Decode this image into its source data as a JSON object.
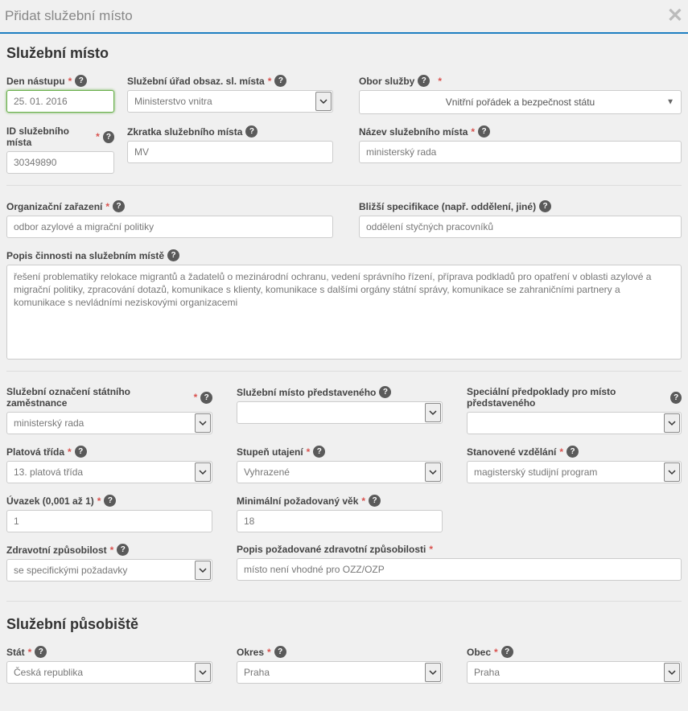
{
  "modal": {
    "title": "Přidat služební místo"
  },
  "section1": {
    "title": "Služební místo"
  },
  "fields": {
    "den_nastupu": {
      "label": "Den nástupu",
      "value": "25. 01. 2016"
    },
    "urad": {
      "label": "Služební úřad obsaz. sl. místa",
      "value": "Ministerstvo vnitra"
    },
    "obor": {
      "label": "Obor služby",
      "value": "Vnitřní pořádek a bezpečnost státu"
    },
    "id_mista": {
      "label": "ID služebního místa",
      "value": "30349890"
    },
    "zkratka": {
      "label": "Zkratka služebního místa",
      "value": "MV"
    },
    "nazev": {
      "label": "Název služebního místa",
      "value": "ministerský rada"
    },
    "organizacni": {
      "label": "Organizační zařazení",
      "value": "odbor azylové a migrační politiky"
    },
    "blizsi": {
      "label": "Bližší specifikace (např. oddělení, jiné)",
      "value": "oddělení styčných pracovníků"
    },
    "popis_cinnosti": {
      "label": "Popis činnosti na služebním místě",
      "value": "řešení problematiky relokace migrantů a žadatelů o mezinárodní ochranu, vedení správního řízení, příprava podkladů pro opatření v oblasti azylové a migrační politiky, zpracování dotazů, komunikace s klienty, komunikace s dalšími orgány státní správy, komunikace se zahraničními partnery a komunikace s nevládními neziskovými organizacemi"
    },
    "oznaceni": {
      "label": "Služební označení státního zaměstnance",
      "value": "ministerský rada"
    },
    "predstaveny": {
      "label": "Služební místo představeného",
      "value": ""
    },
    "spec_predpoklady": {
      "label": "Speciální předpoklady pro místo představeného",
      "value": ""
    },
    "platova": {
      "label": "Platová třída",
      "value": "13. platová třída"
    },
    "utajeni": {
      "label": "Stupeň utajení",
      "value": "Vyhrazené"
    },
    "vzdelani": {
      "label": "Stanovené vzdělání",
      "value": "magisterský studijní program"
    },
    "uvazek": {
      "label": "Úvazek (0,001 až 1)",
      "value": "1"
    },
    "min_vek": {
      "label": "Minimální požadovaný věk",
      "value": "18"
    },
    "zdrav": {
      "label": "Zdravotní způsobilost",
      "value": "se specifickými požadavky"
    },
    "popis_zdrav": {
      "label": "Popis požadované zdravotní způsobilosti",
      "value": "místo není vhodné pro OZZ/OZP"
    }
  },
  "section2": {
    "title": "Služební působiště"
  },
  "location": {
    "stat": {
      "label": "Stát",
      "value": "Česká republika"
    },
    "okres": {
      "label": "Okres",
      "value": "Praha"
    },
    "obec": {
      "label": "Obec",
      "value": "Praha"
    }
  }
}
